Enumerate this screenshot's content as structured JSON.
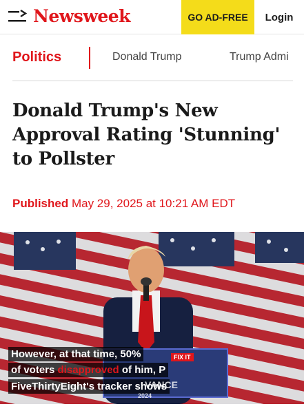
{
  "header": {
    "logo": "Newsweek",
    "ad_free_label": "GO AD-FREE",
    "login_label": "Login"
  },
  "section_nav": {
    "active": "Politics",
    "items": [
      "Donald Trump",
      "Trump Admi"
    ]
  },
  "article": {
    "headline": "Donald Trump's New Approval Rating 'Stunning' to Pollster",
    "published_label": "Published",
    "published_date": "May 29, 2025 at 10:21 AM EDT"
  },
  "video": {
    "caption_line1": "However, at that time, 50%",
    "caption_line2_pre": "of voters ",
    "caption_line2_highlight": "disapproved",
    "caption_line2_post": " of him, P",
    "caption_line3": "FiveThirtyEight's tracker shows",
    "podium_badge": "FIX IT",
    "podium_text": "VANCE",
    "podium_year": "2024"
  },
  "colors": {
    "brand_red": "#e0161b",
    "ad_free_yellow": "#f4dc1a",
    "text_dark": "#1a1a1a"
  }
}
